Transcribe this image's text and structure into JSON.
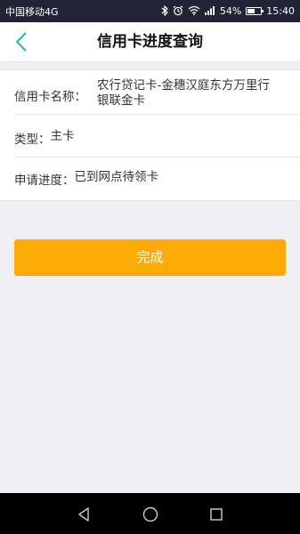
{
  "status_bar": {
    "carrier": "中国移动4G",
    "battery_percent": "54%",
    "battery_level": 0.54,
    "time": "15:40",
    "icons": [
      "bluetooth-icon",
      "alarm-icon",
      "wifi-icon",
      "signal-icon",
      "battery-icon"
    ]
  },
  "header": {
    "title": "信用卡进度查询",
    "back_icon": "chevron-left-icon",
    "accent_color": "#2bb3a8"
  },
  "info": {
    "card_name_label": "信用卡名称：",
    "card_name_value_line1": "农行贷记卡-金穗汉庭东方万里行",
    "card_name_value_line2": "银联金卡",
    "type_label": "类型：",
    "type_value": "主卡",
    "progress_label": "申请进度：",
    "progress_value": "已到网点待领卡"
  },
  "actions": {
    "done_label": "完成",
    "done_color": "#fbaa06"
  },
  "android_nav": {
    "icons": [
      "back-triangle-icon",
      "home-circle-icon",
      "recents-square-icon"
    ]
  }
}
